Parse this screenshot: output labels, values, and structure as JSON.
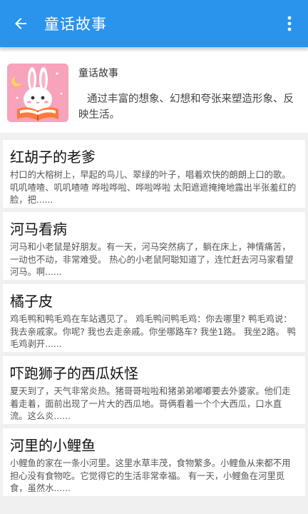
{
  "appbar": {
    "title": "童话故事",
    "back_icon": "arrow-left-icon",
    "more_icon": "more-vert-icon",
    "color": "#2a93ec"
  },
  "header": {
    "title": "童话故事",
    "description": "通过丰富的想象、幻想和夸张来塑造形象、反映生活。"
  },
  "stories": [
    {
      "title": "红胡子的老爹",
      "summary": "村口的大榕树上，早起的鸟儿、翠绿的叶子，唱着欢快的朗朗上口的歌。 叽叽喳喳、叽叽喳喳 哗啦哗啦、哗啦哗啦 太阳遮遮掩掩地露出半张羞红的脸，把......"
    },
    {
      "title": "河马看病",
      "summary": "河马和小老鼠是好朋友。有一天，河马突然病了，躺在床上，神情痛苦，一动也不动，非常难受。 热心的小老鼠阿聪知道了，连忙赶去河马家看望河马。啊......"
    },
    {
      "title": "橘子皮",
      "summary": "鸡毛鸭和鸭毛鸡在车站遇见了。 鸡毛鸭问鸭毛鸡：你去哪里? 鸭毛鸡说：我去亲戚家。你呢? 我也去走亲戚。你坐哪路车? 我坐1路。 我坐2路。 鸭毛鸡剥开......"
    },
    {
      "title": "吓跑狮子的西瓜妖怪",
      "summary": "夏天到了，天气非常炎热。猪哥哥啦啦和猪弟弟嘟嘟要去外婆家。他们走着走着，面前出现了一片大的西瓜地。哥俩看着一个个大西瓜，口水直流。这么炎......"
    },
    {
      "title": "河里的小鲤鱼",
      "summary": "小鲤鱼的家在一条小河里。这里水草丰茂，食物繁多。小鲤鱼从来都不用担心没有食物吃。它觉得它的生活非常幸福。 有一天，小鲤鱼在河里觅食，虽然水......"
    }
  ]
}
